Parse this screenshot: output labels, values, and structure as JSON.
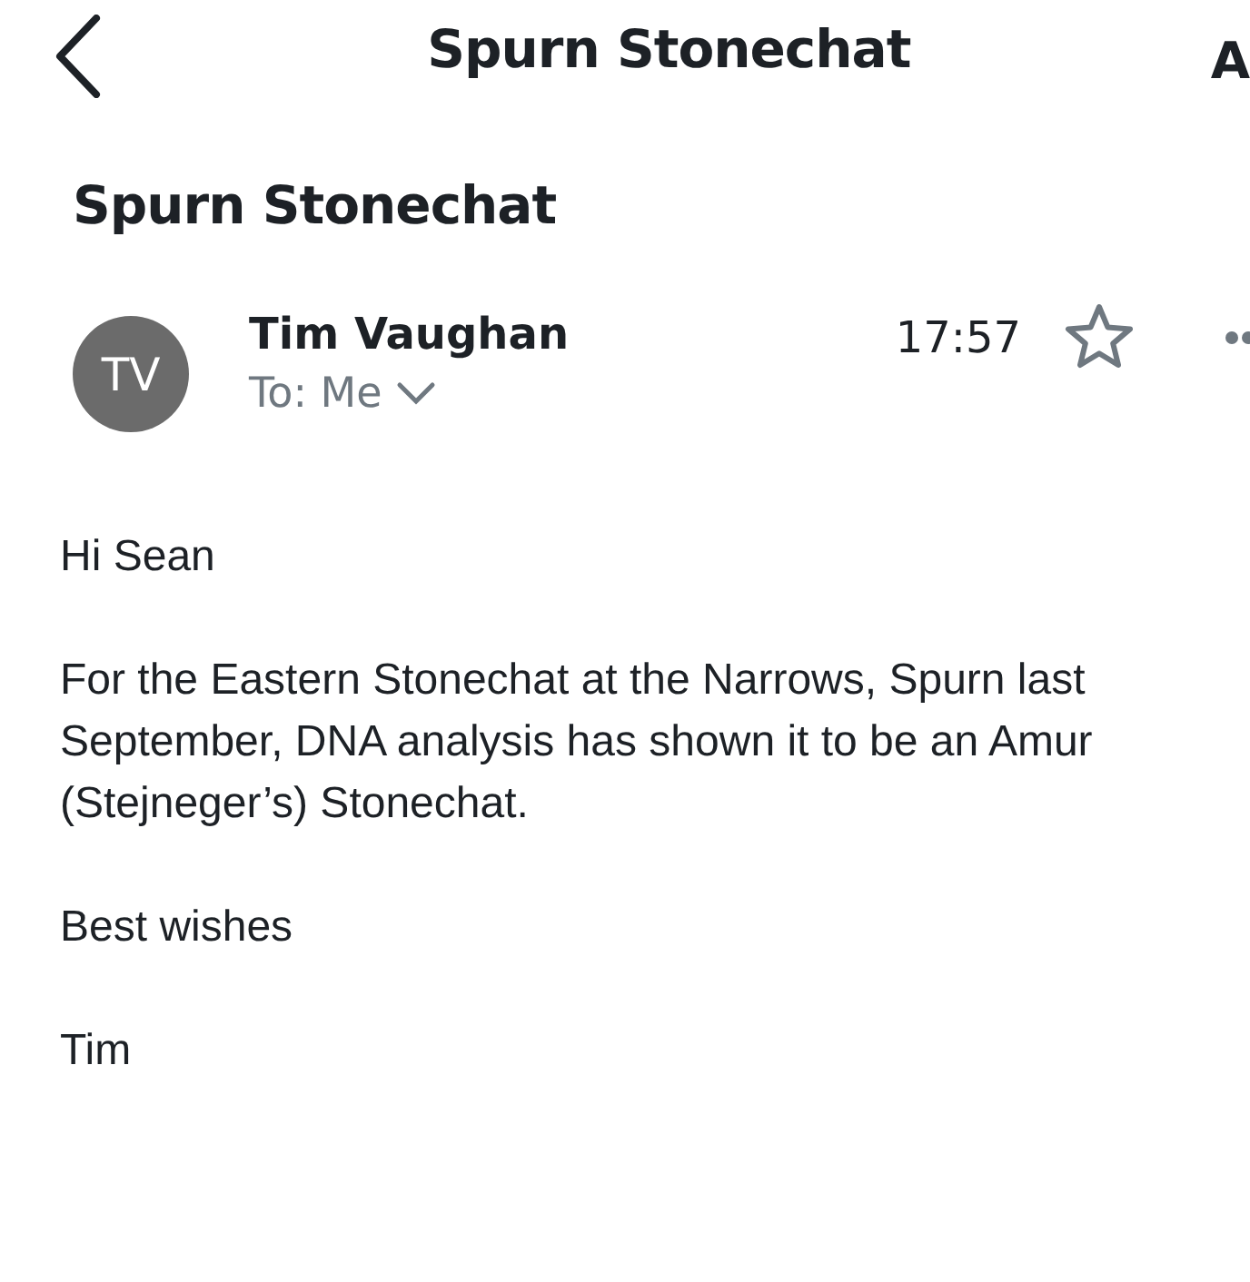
{
  "header": {
    "title": "Spurn Stonechat",
    "cut_text": "A"
  },
  "subject": "Spurn Stonechat",
  "message": {
    "avatar_initials": "TV",
    "sender": "Tim Vaughan",
    "recipient": "To: Me",
    "time": "17:57",
    "starred": false
  },
  "body": [
    "Hi Sean",
    "For the Eastern Stonechat at the Narrows, Spurn last September, DNA analysis has shown it to be an Amur (Stejneger’s) Stonechat.",
    "Best wishes",
    "Tim"
  ]
}
